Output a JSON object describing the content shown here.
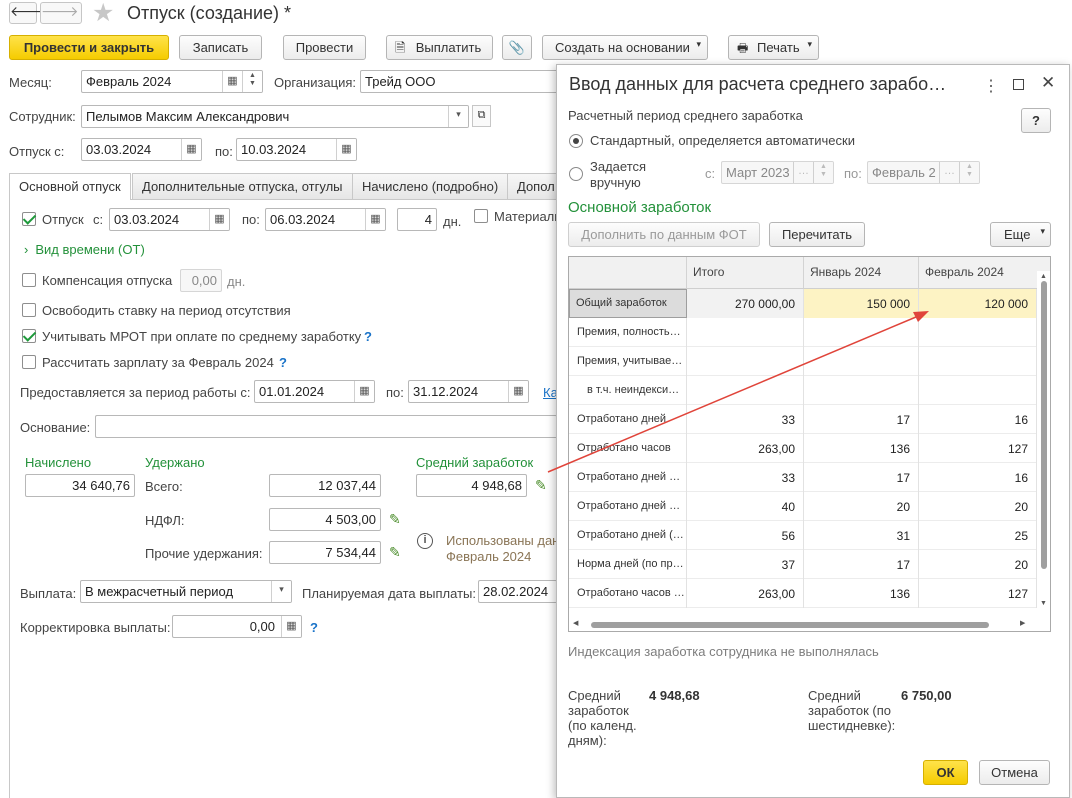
{
  "window": {
    "title": "Отпуск (создание) *"
  },
  "toolbar": {
    "post_close": "Провести и закрыть",
    "save": "Записать",
    "post": "Провести",
    "pay": "Выплатить",
    "create_based": "Создать на основании",
    "print": "Печать"
  },
  "header": {
    "month_label": "Месяц:",
    "month_value": "Февраль 2024",
    "org_label": "Организация:",
    "org_value": "Трейд ООО",
    "employee_label": "Сотрудник:",
    "employee_value": "Пелымов Максим Александрович",
    "vacation_from_label": "Отпуск с:",
    "vacation_from": "03.03.2024",
    "vacation_to_label": "по:",
    "vacation_to": "10.03.2024"
  },
  "tabs": [
    "Основной отпуск",
    "Дополнительные отпуска, отгулы",
    "Начислено (подробно)",
    "Допол"
  ],
  "main": {
    "vacation_label": "Отпуск",
    "from_label": "с:",
    "from": "03.03.2024",
    "to_label": "по:",
    "to": "06.03.2024",
    "days": "4",
    "days_unit": "дн.",
    "material_label": "Материаль",
    "time_type": "Вид времени (ОТ)",
    "compensation_label": "Компенсация отпуска",
    "compensation_value": "0,00",
    "compensation_unit": "дн.",
    "free_rate": "Освободить ставку на период отсутствия",
    "mrot": "Учитывать МРОТ при оплате по среднему заработку",
    "calc_salary": "Рассчитать зарплату за Февраль 2024",
    "work_period_label": "Предоставляется за период работы с:",
    "work_from": "01.01.2024",
    "work_to_label": "по:",
    "work_to": "31.12.2024",
    "calendar_link": "Ка",
    "basis_label": "Основание:",
    "basis_value": "",
    "q": "?"
  },
  "totals": {
    "accrued_label": "Начислено",
    "accrued": "34 640,76",
    "withheld_label": "Удержано",
    "total_label": "Всего:",
    "total": "12 037,44",
    "ndfl_label": "НДФЛ:",
    "ndfl": "4 503,00",
    "other_label": "Прочие удержания:",
    "other": "7 534,44",
    "avg_label": "Средний заработок",
    "avg": "4 948,68",
    "used_info_1": "Использованы дан",
    "used_info_2": "Февраль 2024"
  },
  "payment": {
    "label": "Выплата:",
    "value": "В межрасчетный период",
    "planned_label": "Планируемая дата выплаты:",
    "planned_value": "28.02.2024",
    "correction_label": "Корректировка выплаты:",
    "correction_value": "0,00"
  },
  "dialog": {
    "title": "Ввод данных для расчета среднего зарабо…",
    "period_label": "Расчетный период среднего заработка",
    "standard_option": "Стандартный, определяется автоматически",
    "manual_option_1": "Задается",
    "manual_option_2": "вручную",
    "manual_from_label": "с:",
    "manual_from": "Март 2023",
    "manual_to_label": "по:",
    "manual_to": "Февраль 2",
    "help": "?",
    "section_title": "Основной заработок",
    "fill_button": "Дополнить по данным ФОТ",
    "recalc_button": "Перечитать",
    "more_button": "Еще",
    "columns": [
      "",
      "Итого",
      "Январь 2024",
      "Февраль 2024"
    ],
    "rows": [
      {
        "label": "Общий заработок",
        "total": "270 000,00",
        "jan": "150 000",
        "feb": "120 000"
      },
      {
        "label": "Премия, полность…",
        "total": "",
        "jan": "",
        "feb": ""
      },
      {
        "label": "Премия, учитывае…",
        "total": "",
        "jan": "",
        "feb": ""
      },
      {
        "label": "в т.ч. неиндекси…",
        "total": "",
        "jan": "",
        "feb": ""
      },
      {
        "label": "Отработано дней",
        "total": "33",
        "jan": "17",
        "feb": "16"
      },
      {
        "label": "Отработано часов",
        "total": "263,00",
        "jan": "136",
        "feb": "127"
      },
      {
        "label": "Отработано дней …",
        "total": "33",
        "jan": "17",
        "feb": "16"
      },
      {
        "label": "Отработано дней …",
        "total": "40",
        "jan": "20",
        "feb": "20"
      },
      {
        "label": "Отработано дней (…",
        "total": "56",
        "jan": "31",
        "feb": "25"
      },
      {
        "label": "Норма дней (по пр…",
        "total": "37",
        "jan": "17",
        "feb": "20"
      },
      {
        "label": "Отработано часов …",
        "total": "263,00",
        "jan": "136",
        "feb": "127"
      }
    ],
    "indexation_note": "Индексация заработка сотрудника не выполнялась",
    "avg_calendar_label": "Средний заработок (по календ. дням):",
    "avg_calendar_value": "4 948,68",
    "avg_sixday_label": "Средний заработок (по шестидневке):",
    "avg_sixday_value": "6 750,00",
    "ok": "ОК",
    "cancel": "Отмена"
  }
}
